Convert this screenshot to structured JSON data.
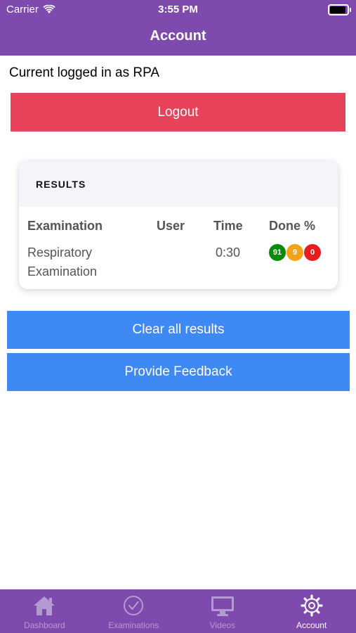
{
  "status_bar": {
    "carrier": "Carrier",
    "time": "3:55 PM"
  },
  "header": {
    "title": "Account"
  },
  "account": {
    "logged_in_text": "Current logged in as RPA",
    "logout_label": "Logout"
  },
  "results": {
    "title": "RESULTS",
    "columns": [
      "Examination",
      "User",
      "Time",
      "Done %"
    ],
    "rows": [
      {
        "examination_line1": "Respiratory",
        "examination_line2": "Examination",
        "user": "",
        "time": "0:30",
        "done": [
          "91",
          "9",
          "0"
        ]
      }
    ]
  },
  "buttons": {
    "clear_results": "Clear all results",
    "feedback": "Provide Feedback"
  },
  "colors": {
    "header": "#7f4aad",
    "logout": "#e8435a",
    "primary": "#3f89f4",
    "done_green": "#0a8a0a",
    "done_orange": "#f2a416",
    "done_red": "#e61e1e"
  },
  "tabbar": {
    "items": [
      {
        "label": "Dashboard",
        "icon": "home-icon"
      },
      {
        "label": "Examinations",
        "icon": "check-circle-icon"
      },
      {
        "label": "Videos",
        "icon": "monitor-icon"
      },
      {
        "label": "Account",
        "icon": "gear-icon",
        "active": true
      }
    ]
  }
}
